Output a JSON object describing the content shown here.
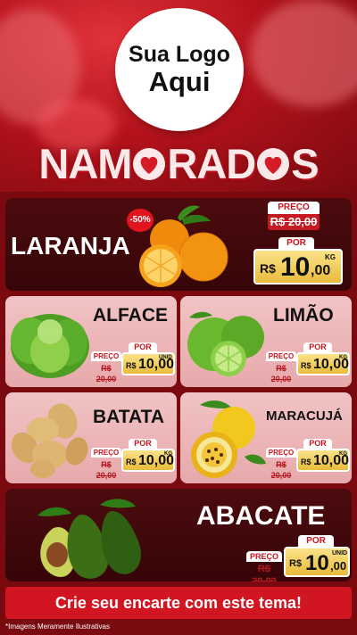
{
  "logo": {
    "line1": "Sua Logo",
    "line2": "Aqui"
  },
  "title": {
    "before": "NAM",
    "after": "RAD",
    "end": "S"
  },
  "featured_top": {
    "name": "LARANJA",
    "discount": "-50%",
    "preco_label": "PREÇO",
    "old_price": "R$ 20,00",
    "por_label": "POR",
    "currency": "R$",
    "price_int": "10",
    "price_dec": ",00",
    "unit": "KG"
  },
  "cards": [
    {
      "name": "ALFACE",
      "preco_label": "PREÇO",
      "old_price": "R$ 20,00",
      "por_label": "POR",
      "currency": "R$",
      "price": "10,00",
      "unit": "UNID"
    },
    {
      "name": "LIMÃO",
      "preco_label": "PREÇO",
      "old_price": "R$ 20,00",
      "por_label": "POR",
      "currency": "R$",
      "price": "10,00",
      "unit": "KG"
    },
    {
      "name": "BATATA",
      "preco_label": "PREÇO",
      "old_price": "R$ 20,00",
      "por_label": "POR",
      "currency": "R$",
      "price": "10,00",
      "unit": "KG"
    },
    {
      "name": "MARACUJÁ",
      "preco_label": "PREÇO",
      "old_price": "R$ 20,00",
      "por_label": "POR",
      "currency": "R$",
      "price": "10,00",
      "unit": "KG"
    }
  ],
  "featured_bottom": {
    "name": "ABACATE",
    "preco_label": "PREÇO",
    "old_price": "R$ 20,00",
    "por_label": "POR",
    "currency": "R$",
    "price_int": "10",
    "price_dec": ",00",
    "unit": "UNID"
  },
  "cta": "Crie seu encarte com este tema!",
  "footnote": "*Imagens Meramente Ilustrativas",
  "colors": {
    "brand_red": "#d11621",
    "dark_card": "#3e080a",
    "light_card": "#eeb7b8",
    "price_gold": "#f2cd5c"
  }
}
